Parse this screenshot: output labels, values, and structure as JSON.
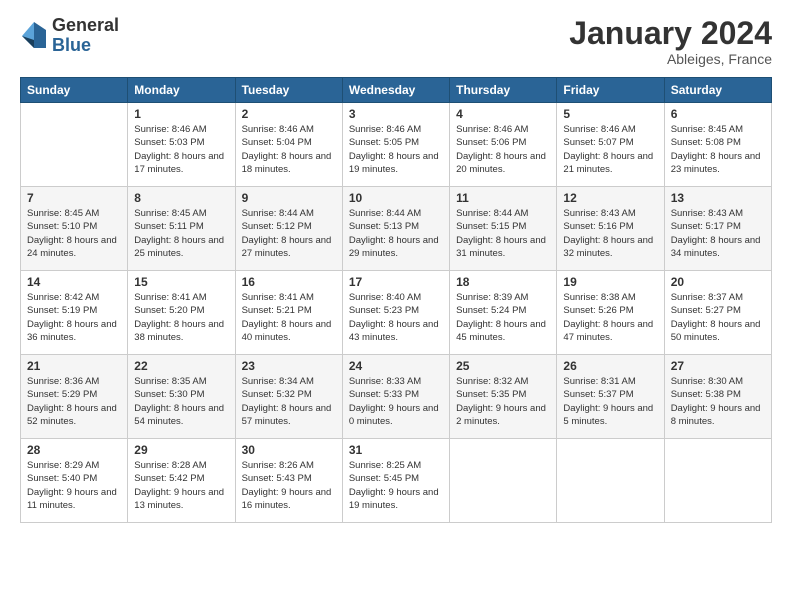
{
  "logo": {
    "general": "General",
    "blue": "Blue"
  },
  "title": "January 2024",
  "location": "Ableiges, France",
  "days_of_week": [
    "Sunday",
    "Monday",
    "Tuesday",
    "Wednesday",
    "Thursday",
    "Friday",
    "Saturday"
  ],
  "weeks": [
    [
      {
        "day": "",
        "sunrise": "",
        "sunset": "",
        "daylight": ""
      },
      {
        "day": "1",
        "sunrise": "Sunrise: 8:46 AM",
        "sunset": "Sunset: 5:03 PM",
        "daylight": "Daylight: 8 hours and 17 minutes."
      },
      {
        "day": "2",
        "sunrise": "Sunrise: 8:46 AM",
        "sunset": "Sunset: 5:04 PM",
        "daylight": "Daylight: 8 hours and 18 minutes."
      },
      {
        "day": "3",
        "sunrise": "Sunrise: 8:46 AM",
        "sunset": "Sunset: 5:05 PM",
        "daylight": "Daylight: 8 hours and 19 minutes."
      },
      {
        "day": "4",
        "sunrise": "Sunrise: 8:46 AM",
        "sunset": "Sunset: 5:06 PM",
        "daylight": "Daylight: 8 hours and 20 minutes."
      },
      {
        "day": "5",
        "sunrise": "Sunrise: 8:46 AM",
        "sunset": "Sunset: 5:07 PM",
        "daylight": "Daylight: 8 hours and 21 minutes."
      },
      {
        "day": "6",
        "sunrise": "Sunrise: 8:45 AM",
        "sunset": "Sunset: 5:08 PM",
        "daylight": "Daylight: 8 hours and 23 minutes."
      }
    ],
    [
      {
        "day": "7",
        "sunrise": "Sunrise: 8:45 AM",
        "sunset": "Sunset: 5:10 PM",
        "daylight": "Daylight: 8 hours and 24 minutes."
      },
      {
        "day": "8",
        "sunrise": "Sunrise: 8:45 AM",
        "sunset": "Sunset: 5:11 PM",
        "daylight": "Daylight: 8 hours and 25 minutes."
      },
      {
        "day": "9",
        "sunrise": "Sunrise: 8:44 AM",
        "sunset": "Sunset: 5:12 PM",
        "daylight": "Daylight: 8 hours and 27 minutes."
      },
      {
        "day": "10",
        "sunrise": "Sunrise: 8:44 AM",
        "sunset": "Sunset: 5:13 PM",
        "daylight": "Daylight: 8 hours and 29 minutes."
      },
      {
        "day": "11",
        "sunrise": "Sunrise: 8:44 AM",
        "sunset": "Sunset: 5:15 PM",
        "daylight": "Daylight: 8 hours and 31 minutes."
      },
      {
        "day": "12",
        "sunrise": "Sunrise: 8:43 AM",
        "sunset": "Sunset: 5:16 PM",
        "daylight": "Daylight: 8 hours and 32 minutes."
      },
      {
        "day": "13",
        "sunrise": "Sunrise: 8:43 AM",
        "sunset": "Sunset: 5:17 PM",
        "daylight": "Daylight: 8 hours and 34 minutes."
      }
    ],
    [
      {
        "day": "14",
        "sunrise": "Sunrise: 8:42 AM",
        "sunset": "Sunset: 5:19 PM",
        "daylight": "Daylight: 8 hours and 36 minutes."
      },
      {
        "day": "15",
        "sunrise": "Sunrise: 8:41 AM",
        "sunset": "Sunset: 5:20 PM",
        "daylight": "Daylight: 8 hours and 38 minutes."
      },
      {
        "day": "16",
        "sunrise": "Sunrise: 8:41 AM",
        "sunset": "Sunset: 5:21 PM",
        "daylight": "Daylight: 8 hours and 40 minutes."
      },
      {
        "day": "17",
        "sunrise": "Sunrise: 8:40 AM",
        "sunset": "Sunset: 5:23 PM",
        "daylight": "Daylight: 8 hours and 43 minutes."
      },
      {
        "day": "18",
        "sunrise": "Sunrise: 8:39 AM",
        "sunset": "Sunset: 5:24 PM",
        "daylight": "Daylight: 8 hours and 45 minutes."
      },
      {
        "day": "19",
        "sunrise": "Sunrise: 8:38 AM",
        "sunset": "Sunset: 5:26 PM",
        "daylight": "Daylight: 8 hours and 47 minutes."
      },
      {
        "day": "20",
        "sunrise": "Sunrise: 8:37 AM",
        "sunset": "Sunset: 5:27 PM",
        "daylight": "Daylight: 8 hours and 50 minutes."
      }
    ],
    [
      {
        "day": "21",
        "sunrise": "Sunrise: 8:36 AM",
        "sunset": "Sunset: 5:29 PM",
        "daylight": "Daylight: 8 hours and 52 minutes."
      },
      {
        "day": "22",
        "sunrise": "Sunrise: 8:35 AM",
        "sunset": "Sunset: 5:30 PM",
        "daylight": "Daylight: 8 hours and 54 minutes."
      },
      {
        "day": "23",
        "sunrise": "Sunrise: 8:34 AM",
        "sunset": "Sunset: 5:32 PM",
        "daylight": "Daylight: 8 hours and 57 minutes."
      },
      {
        "day": "24",
        "sunrise": "Sunrise: 8:33 AM",
        "sunset": "Sunset: 5:33 PM",
        "daylight": "Daylight: 9 hours and 0 minutes."
      },
      {
        "day": "25",
        "sunrise": "Sunrise: 8:32 AM",
        "sunset": "Sunset: 5:35 PM",
        "daylight": "Daylight: 9 hours and 2 minutes."
      },
      {
        "day": "26",
        "sunrise": "Sunrise: 8:31 AM",
        "sunset": "Sunset: 5:37 PM",
        "daylight": "Daylight: 9 hours and 5 minutes."
      },
      {
        "day": "27",
        "sunrise": "Sunrise: 8:30 AM",
        "sunset": "Sunset: 5:38 PM",
        "daylight": "Daylight: 9 hours and 8 minutes."
      }
    ],
    [
      {
        "day": "28",
        "sunrise": "Sunrise: 8:29 AM",
        "sunset": "Sunset: 5:40 PM",
        "daylight": "Daylight: 9 hours and 11 minutes."
      },
      {
        "day": "29",
        "sunrise": "Sunrise: 8:28 AM",
        "sunset": "Sunset: 5:42 PM",
        "daylight": "Daylight: 9 hours and 13 minutes."
      },
      {
        "day": "30",
        "sunrise": "Sunrise: 8:26 AM",
        "sunset": "Sunset: 5:43 PM",
        "daylight": "Daylight: 9 hours and 16 minutes."
      },
      {
        "day": "31",
        "sunrise": "Sunrise: 8:25 AM",
        "sunset": "Sunset: 5:45 PM",
        "daylight": "Daylight: 9 hours and 19 minutes."
      },
      {
        "day": "",
        "sunrise": "",
        "sunset": "",
        "daylight": ""
      },
      {
        "day": "",
        "sunrise": "",
        "sunset": "",
        "daylight": ""
      },
      {
        "day": "",
        "sunrise": "",
        "sunset": "",
        "daylight": ""
      }
    ]
  ]
}
